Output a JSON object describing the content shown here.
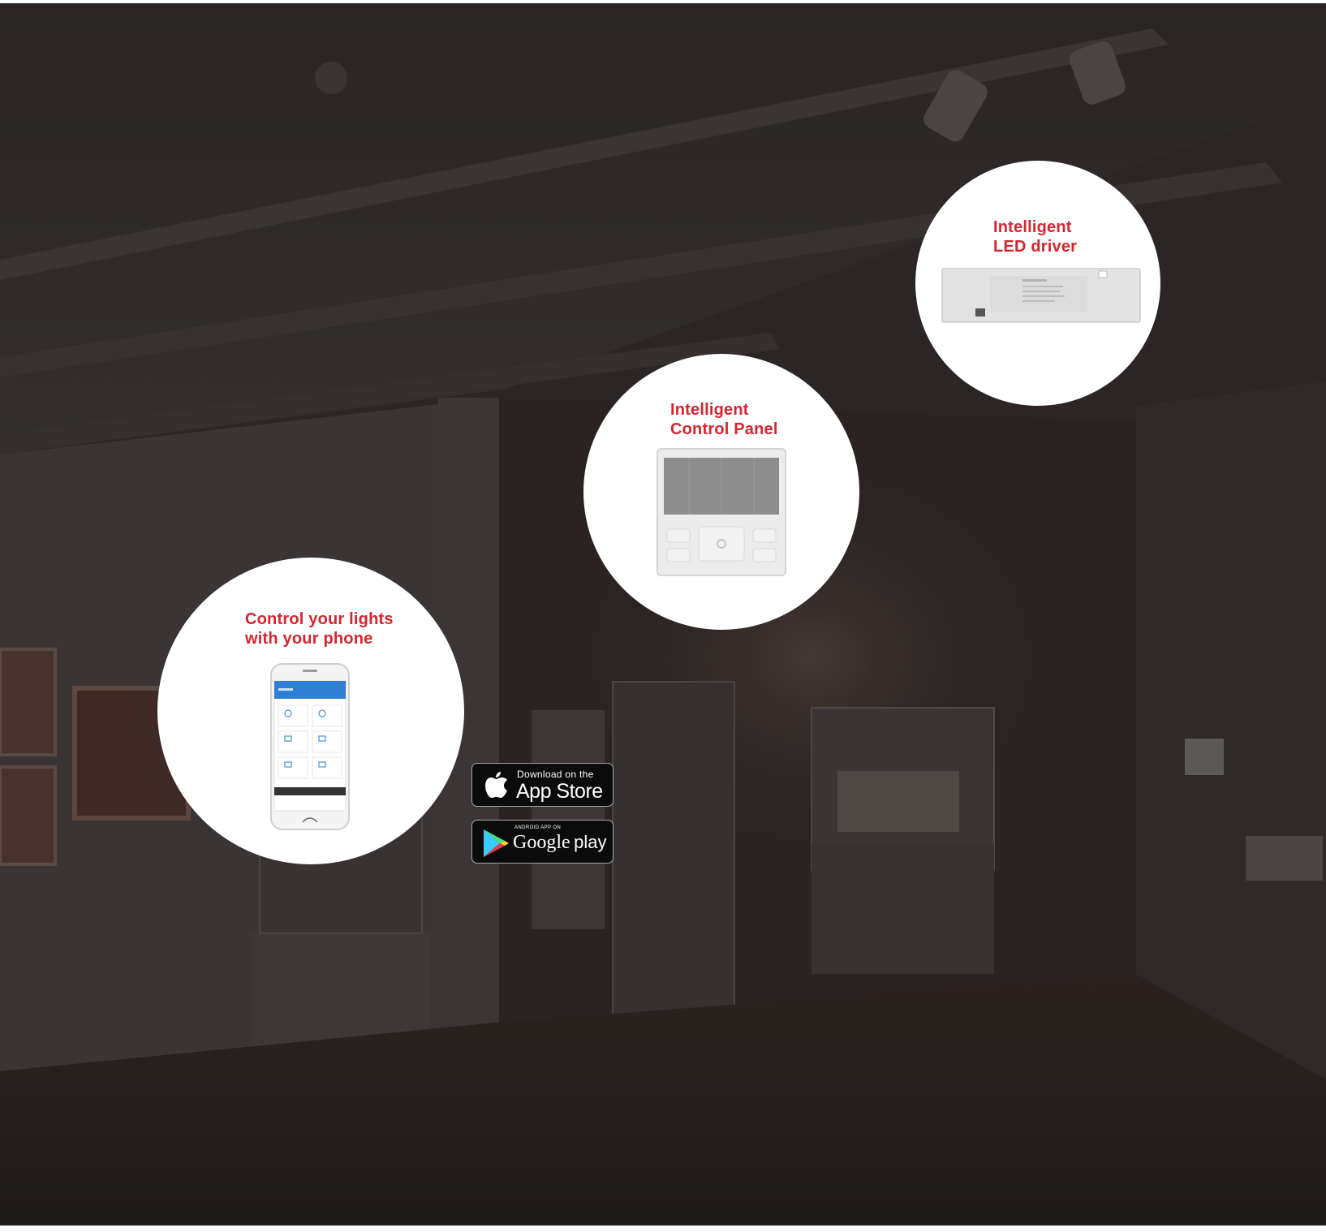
{
  "colors": {
    "title_red": "#d6252f",
    "scene_dark": "#2b2625",
    "bubble_bg": "#ffffff",
    "badge_bg": "#0b0b0b",
    "app_header_blue": "#2f7fd4"
  },
  "bubbles": {
    "phone": {
      "title_line1": "Control your lights",
      "title_line2": "with your phone",
      "product_icon": "smartphone-app-icon"
    },
    "panel": {
      "title_line1": "Intelligent",
      "title_line2": "Control Panel",
      "product_icon": "wall-control-panel-icon"
    },
    "driver": {
      "title_line1": "Intelligent",
      "title_line2": "LED driver",
      "product_icon": "led-driver-icon"
    }
  },
  "badges": {
    "app_store": {
      "small_text": "Download on the",
      "big_text": "App Store",
      "icon": "apple-icon"
    },
    "google_play": {
      "small_text": "ANDROID APP ON",
      "big_text_word1": "Google",
      "big_text_word2": "play",
      "icon": "play-triangle-icon"
    }
  }
}
